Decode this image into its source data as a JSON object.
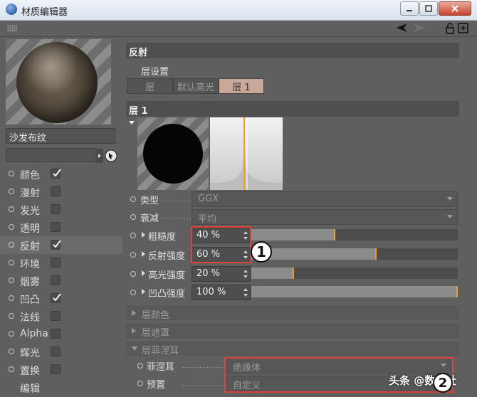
{
  "window": {
    "title": "材质编辑器"
  },
  "material": {
    "name": "沙发布纹"
  },
  "channels": [
    {
      "label": "颜色",
      "checked": true
    },
    {
      "label": "漫射",
      "checked": false
    },
    {
      "label": "发光",
      "checked": false
    },
    {
      "label": "透明",
      "checked": false
    },
    {
      "label": "反射",
      "checked": true,
      "active": true
    },
    {
      "label": "环境",
      "checked": false
    },
    {
      "label": "烟雾",
      "checked": false
    },
    {
      "label": "凹凸",
      "checked": true
    },
    {
      "label": "法线",
      "checked": false
    },
    {
      "label": "Alpha",
      "checked": false
    },
    {
      "label": "辉光",
      "checked": false
    },
    {
      "label": "置换",
      "checked": false
    },
    {
      "label": "编辑",
      "checked": null
    }
  ],
  "reflect": {
    "header": "反射",
    "layer_settings_label": "层设置",
    "tabs": [
      "层",
      "默认高光",
      "层 1"
    ],
    "active_tab": 2
  },
  "layer1": {
    "header": "层 1",
    "type_label": "类型",
    "type_value": "GGX",
    "attenuation_label": "衰减",
    "attenuation_value": "平均",
    "params": [
      {
        "label": "粗糙度",
        "value": "40 %",
        "fraction": 0.4
      },
      {
        "label": "反射强度",
        "value": "60 %",
        "fraction": 0.6
      },
      {
        "label": "高光强度",
        "value": "20 %",
        "fraction": 0.2
      },
      {
        "label": "凹凸强度",
        "value": "100 %",
        "fraction": 1.0
      }
    ],
    "collapsed_groups": [
      "层颜色",
      "层遮罩"
    ],
    "fresnel_group": "层菲涅耳",
    "fresnel_label": "菲涅耳",
    "fresnel_value": "绝缘体",
    "preset_label": "预置",
    "preset_value": "自定义"
  },
  "annotations": {
    "badge1": "1",
    "badge2": "2"
  },
  "watermark": "头条 @数艺社",
  "colors": {
    "highlight": "#e0413a",
    "active_tab": "#c8a898",
    "slider_knob": "#f0a020"
  }
}
